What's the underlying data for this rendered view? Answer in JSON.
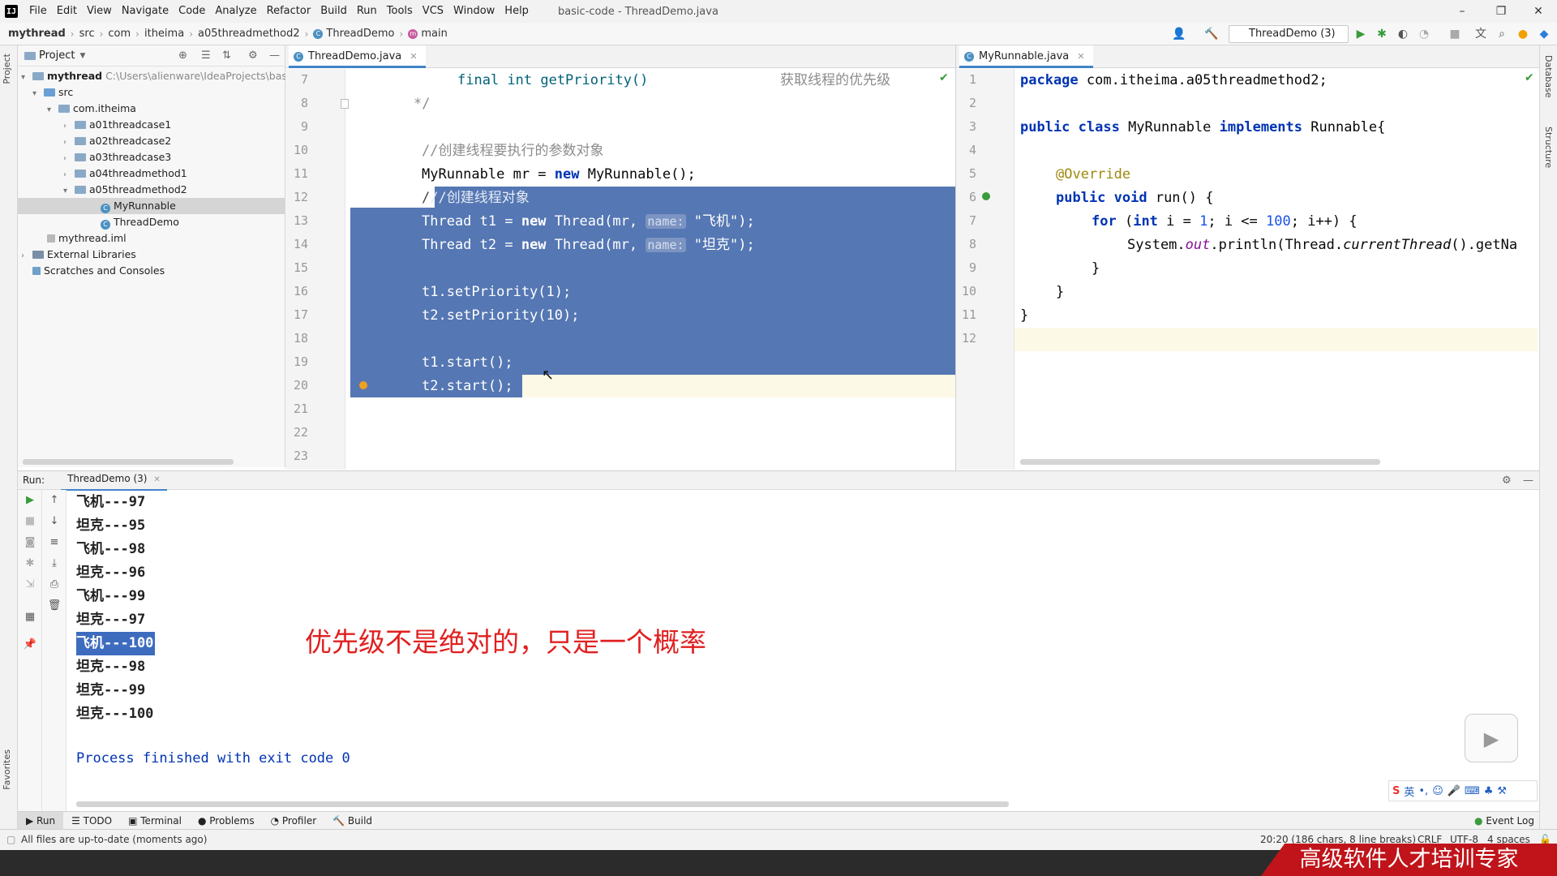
{
  "titlebar": {
    "app_icon": "IJ",
    "menu": [
      "File",
      "Edit",
      "View",
      "Navigate",
      "Code",
      "Analyze",
      "Refactor",
      "Build",
      "Run",
      "Tools",
      "VCS",
      "Window",
      "Help"
    ],
    "window_title": "basic-code - ThreadDemo.java",
    "minimize": "–",
    "maximize": "❐",
    "close": "✕"
  },
  "breadcrumb": {
    "items": [
      "mythread",
      "src",
      "com",
      "itheima",
      "a05threadmethod2",
      "ThreadDemo",
      "main"
    ]
  },
  "toolbar": {
    "run_config": "ThreadDemo (3)"
  },
  "left_strip": {
    "project_tab": "Project",
    "favorites_tab": "Favorites"
  },
  "right_strip": {
    "database_tab": "Database",
    "structure_tab": "Structure"
  },
  "project_panel": {
    "title": "Project",
    "tree": [
      {
        "label": "mythread",
        "extra": "C:\\Users\\alienware\\IdeaProjects\\basic-"
      },
      {
        "label": "src"
      },
      {
        "label": "com.itheima"
      },
      {
        "label": "a01threadcase1"
      },
      {
        "label": "a02threadcase2"
      },
      {
        "label": "a03threadcase3"
      },
      {
        "label": "a04threadmethod1"
      },
      {
        "label": "a05threadmethod2"
      },
      {
        "label": "MyRunnable"
      },
      {
        "label": "ThreadDemo"
      },
      {
        "label": "mythread.iml"
      },
      {
        "label": "External Libraries"
      },
      {
        "label": "Scratches and Consoles"
      }
    ]
  },
  "left_editor": {
    "tab": "ThreadDemo.java",
    "line_numbers": [
      "7",
      "8",
      "9",
      "10",
      "11",
      "12",
      "13",
      "14",
      "15",
      "16",
      "17",
      "18",
      "19",
      "20",
      "21",
      "22",
      "23"
    ],
    "lines": {
      "l7_code": "final int getPriority()",
      "l7_comment": "获取线程的优先级",
      "l8": "*/",
      "l10": "//创建线程要执行的参数对象",
      "l11_type": "MyRunnable mr = ",
      "l11_new": "new",
      "l11_rest": " MyRunnable();",
      "l12": "//创建线程对象",
      "l13_a": "Thread t1 = ",
      "l13_new": "new",
      "l13_b": " Thread(mr, ",
      "l13_hint": "name:",
      "l13_str": " \"飞机\"",
      "l13_c": ");",
      "l14_a": "Thread t2 = ",
      "l14_new": "new",
      "l14_b": " Thread(mr, ",
      "l14_hint": "name:",
      "l14_str": " \"坦克\"",
      "l14_c": ");",
      "l16": "t1.setPriority(1);",
      "l17": "t2.setPriority(10);",
      "l19": "t1.start();",
      "l20": "t2.start();"
    }
  },
  "right_editor": {
    "tab": "MyRunnable.java",
    "line_numbers": [
      "1",
      "2",
      "3",
      "4",
      "5",
      "6",
      "7",
      "8",
      "9",
      "10",
      "11",
      "12"
    ],
    "lines": {
      "l1_kw": "package",
      "l1_rest": " com.itheima.a05threadmethod2;",
      "l3_kw": "public class",
      "l3_name": " MyRunnable ",
      "l3_kw2": "implements",
      "l3_rest": " Runnable{",
      "l5": "@Override",
      "l6_kw": "public void",
      "l6_rest": " run() {",
      "l7_kw": "for",
      "l7_a": " (",
      "l7_int": "int",
      "l7_b": " i = ",
      "l7_1": "1",
      "l7_c": "; i <= ",
      "l7_100": "100",
      "l7_d": "; i++) {",
      "l8_a": "System.",
      "l8_out": "out",
      "l8_b": ".println(Thread.",
      "l8_cur": "currentThread",
      "l8_c": "().getNa",
      "l9": "}",
      "l10": "}",
      "l11": "}"
    }
  },
  "run_panel": {
    "label": "Run:",
    "tab": "ThreadDemo (3)",
    "output": [
      "飞机---97",
      "坦克---95",
      "飞机---98",
      "坦克---96",
      "飞机---99",
      "坦克---97",
      "飞机---100",
      "坦克---98",
      "坦克---99",
      "坦克---100"
    ],
    "exit": "Process finished with exit code 0",
    "annotation": "优先级不是绝对的，只是一个概率"
  },
  "bottom_tabs": [
    "Run",
    "TODO",
    "Terminal",
    "Problems",
    "Profiler",
    "Build"
  ],
  "event_log": "Event Log",
  "status": {
    "left": "All files are up-to-date (moments ago)",
    "position": "20:20 (186 chars, 8 line breaks)",
    "line_sep": "CRLF",
    "encoding": "UTF-8",
    "indent": "4 spaces"
  },
  "ime": {
    "label": "英"
  },
  "watermark": "高级软件人才培训专家"
}
